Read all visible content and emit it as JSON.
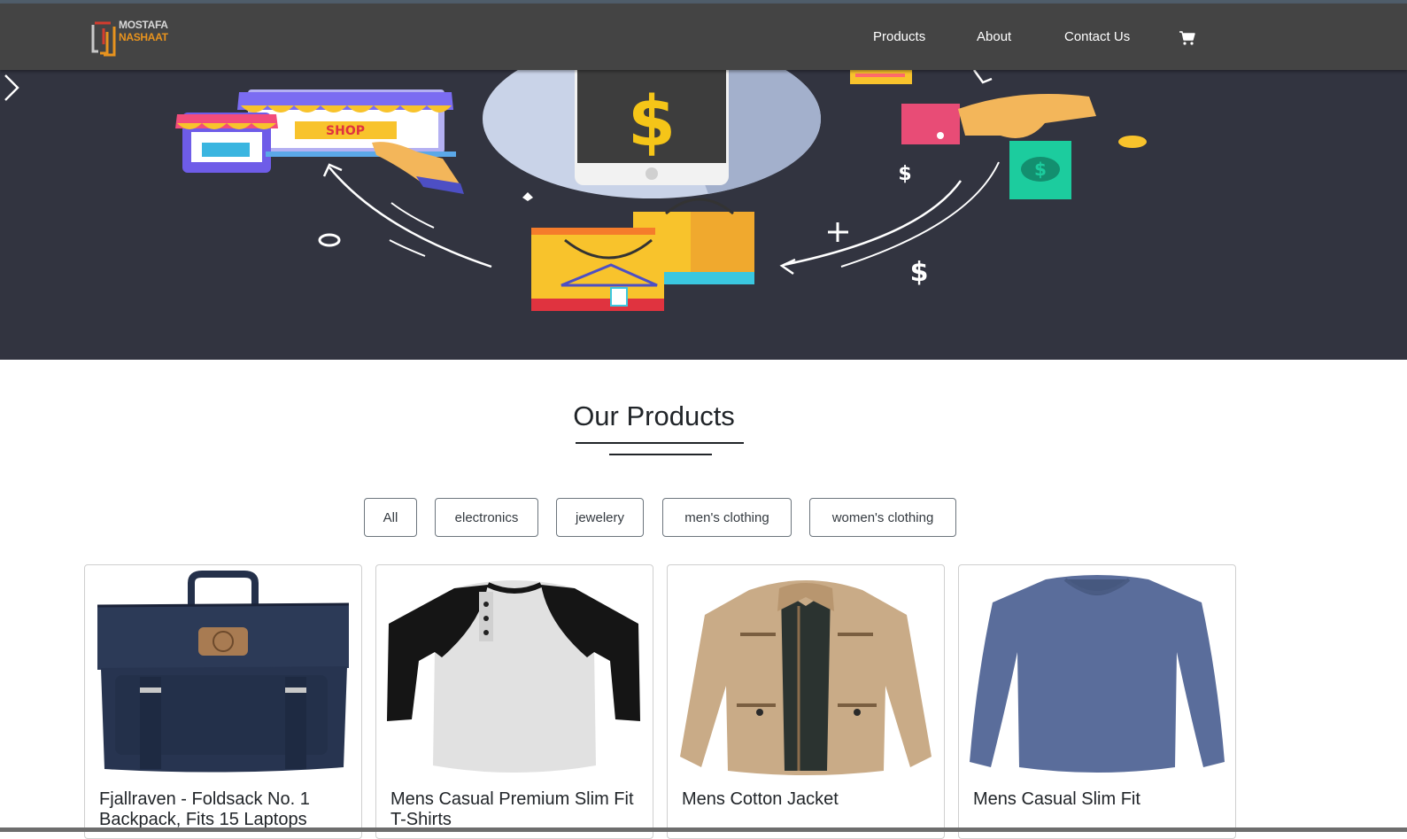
{
  "brand": {
    "line1": "MOSTAFA",
    "line2": "NASHAAT",
    "icon": "brand-logo"
  },
  "nav": {
    "links": [
      "Products",
      "About",
      "Contact Us"
    ],
    "cart_icon": "cart-icon"
  },
  "hero": {
    "next_icon": "chevron-right-icon",
    "badge_text": "SHOP"
  },
  "products_section": {
    "title": "Our Products",
    "filters": [
      "All",
      "electronics",
      "jewelery",
      "men's clothing",
      "women's clothing"
    ]
  },
  "products": [
    {
      "title": "Fjallraven - Foldsack No. 1 Backpack, Fits 15 Laptops",
      "image": "backpack-image"
    },
    {
      "title": "Mens Casual Premium Slim Fit T-Shirts",
      "image": "raglan-tshirt-image"
    },
    {
      "title": "Mens Cotton Jacket",
      "image": "cotton-jacket-image"
    },
    {
      "title": "Mens Casual Slim Fit",
      "image": "long-sleeve-shirt-image"
    }
  ],
  "colors": {
    "navbar": "#444444",
    "hero_bg": "#323440",
    "brand_orange": "#e8931e"
  }
}
